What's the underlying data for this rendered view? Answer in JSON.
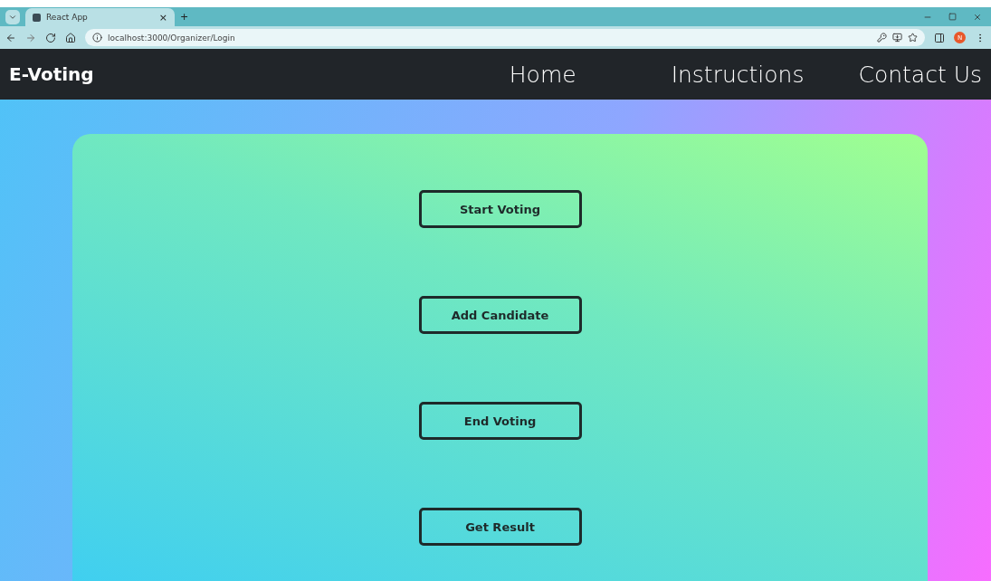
{
  "browser": {
    "tab_title": "React App",
    "tab_close": "×",
    "new_tab": "+",
    "url": "localhost:3000/Organizer/Login",
    "avatar": "N"
  },
  "navbar": {
    "brand": "E-Voting",
    "links": [
      "Home",
      "Instructions",
      "Contact Us"
    ]
  },
  "actions": [
    "Start Voting",
    "Add Candidate",
    "End Voting",
    "Get Result"
  ]
}
